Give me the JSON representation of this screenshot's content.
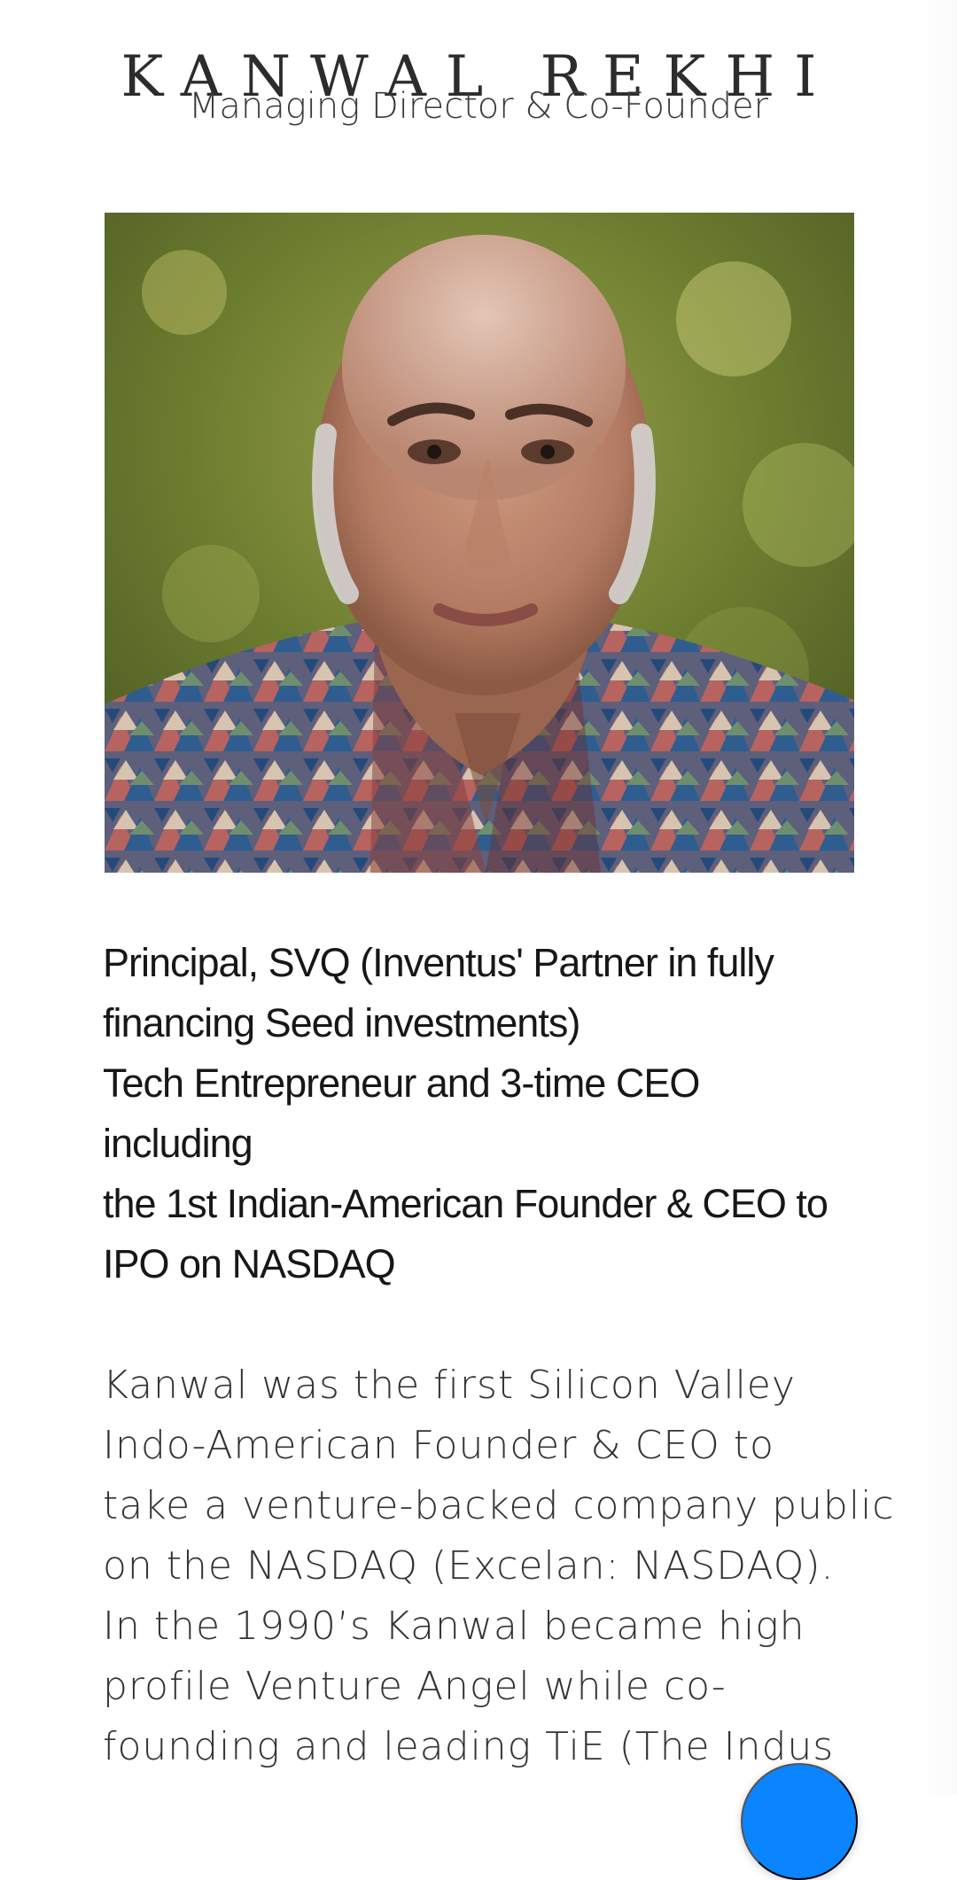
{
  "profile": {
    "name": "KANWAL REKHI",
    "role": "Managing Director & Co-Founder"
  },
  "photo": {
    "alt": "Portrait of Kanwal Rekhi"
  },
  "headline_lines": [
    "Principal, SVQ (Inventus' Partner in fully",
    "financing Seed investments)",
    "Tech Entrepreneur and 3-time CEO",
    "including",
    "the 1st Indian-American Founder & CEO to",
    "IPO on NASDAQ"
  ],
  "bio_lines": [
    "Kanwal was the first Silicon Valley",
    "Indo-American Founder & CEO to",
    "take a venture-backed company public",
    "on the NASDAQ (Excelan: NASDAQ).",
    "In the 1990’s Kanwal became high",
    "profile Venture Angel while co-",
    "founding and leading TiE (The Indus"
  ],
  "fab": {
    "icon": "chat-icon"
  },
  "colors": {
    "fab": "#0b84ff",
    "text": "#1f1f1f"
  }
}
